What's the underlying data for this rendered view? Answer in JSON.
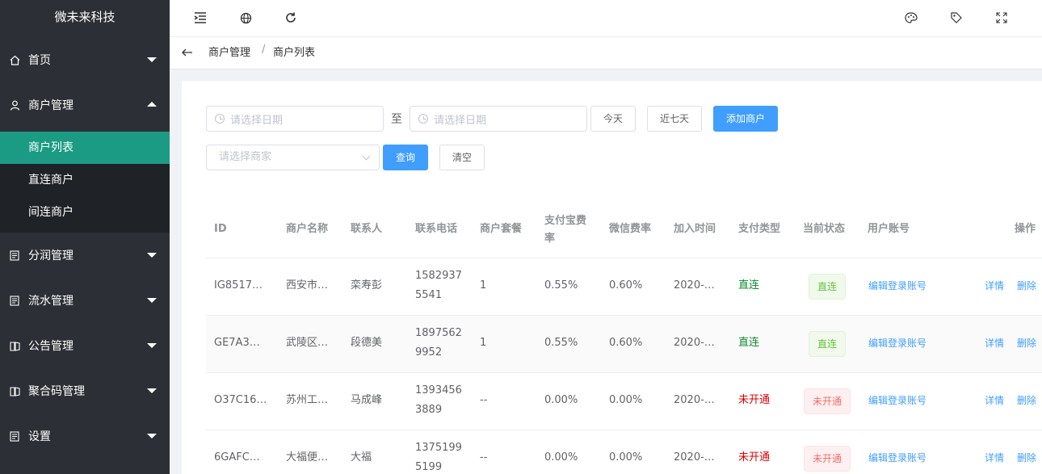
{
  "app": {
    "title": "微未来科技"
  },
  "sidebar": {
    "items": [
      {
        "label": "首页",
        "icon": "home-icon"
      },
      {
        "label": "商户管理",
        "icon": "user-icon"
      },
      {
        "label": "分润管理",
        "icon": "document-icon"
      },
      {
        "label": "流水管理",
        "icon": "document-icon"
      },
      {
        "label": "公告管理",
        "icon": "notice-icon"
      },
      {
        "label": "聚合码管理",
        "icon": "notice-icon"
      },
      {
        "label": "设置",
        "icon": "document-icon"
      }
    ],
    "submenu": [
      {
        "label": "商户列表",
        "active": true
      },
      {
        "label": "直连商户"
      },
      {
        "label": "间连商户"
      }
    ]
  },
  "topbar": {
    "icons": [
      "menu-fold-icon",
      "globe-icon",
      "refresh-icon",
      "palette-icon",
      "tag-icon",
      "fullscreen-icon"
    ]
  },
  "breadcrumb": {
    "items": [
      "商户管理",
      "商户列表"
    ],
    "separator": "/"
  },
  "filters": {
    "start_date_placeholder": "请选择日期",
    "to_label": "至",
    "end_date_placeholder": "请选择日期",
    "today_label": "今天",
    "last7_label": "近七天",
    "add_label": "添加商户",
    "merchant_placeholder": "请选择商家",
    "query_label": "查询",
    "clear_label": "清空"
  },
  "table": {
    "columns": [
      "ID",
      "商户名称",
      "联系人",
      "联系电话",
      "商户套餐",
      "支付宝费率",
      "微信费率",
      "加入时间",
      "支付类型",
      "当前状态",
      "用户账号",
      "操作"
    ],
    "rows": [
      {
        "id": "IG8517…",
        "name": "西安市…",
        "contact": "栾寿彭",
        "phone1": "1582937",
        "phone2": "5541",
        "package": "1",
        "alipay": "0.55%",
        "wechat": "0.60%",
        "joined": "2020-…",
        "paytype": "直连",
        "status": "直连",
        "account": "编辑登录账号",
        "detail": "详情",
        "delete": "删除"
      },
      {
        "id": "GE7A3…",
        "name": "武陵区…",
        "contact": "段德美",
        "phone1": "1897562",
        "phone2": "9952",
        "package": "1",
        "alipay": "0.55%",
        "wechat": "0.60%",
        "joined": "2020-…",
        "paytype": "直连",
        "status": "直连",
        "account": "编辑登录账号",
        "detail": "详情",
        "delete": "删除"
      },
      {
        "id": "O37C16…",
        "name": "苏州工…",
        "contact": "马成峰",
        "phone1": "1393456",
        "phone2": "3889",
        "package": "--",
        "alipay": "0.00%",
        "wechat": "0.00%",
        "joined": "2020-…",
        "paytype": "未开通",
        "status": "未开通",
        "account": "编辑登录账号",
        "detail": "详情",
        "delete": "删除"
      },
      {
        "id": "6GAFC…",
        "name": "大福便…",
        "contact": "大福",
        "phone1": "1375199",
        "phone2": "5199",
        "package": "--",
        "alipay": "0.00%",
        "wechat": "0.00%",
        "joined": "2020-…",
        "paytype": "未开通",
        "status": "未开通",
        "account": "编辑登录账号",
        "detail": "详情",
        "delete": "删除"
      }
    ]
  },
  "colors": {
    "sidebar_bg": "#2c2f35",
    "active_menu": "#1b9b83",
    "primary": "#409eff",
    "connected": "#0a8a2a",
    "not_open": "#e00000"
  }
}
